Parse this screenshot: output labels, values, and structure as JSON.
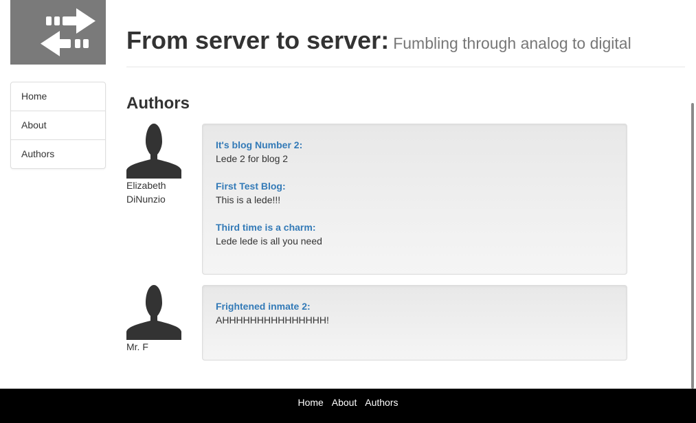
{
  "logo": {
    "icon": "swap-arrows-icon",
    "background": "#7a7a7a"
  },
  "header": {
    "title": "From server to server:",
    "subtitle": "Fumbling through analog to digital"
  },
  "sidenav": {
    "items": [
      {
        "label": "Home"
      },
      {
        "label": "About"
      },
      {
        "label": "Authors"
      }
    ]
  },
  "page": {
    "heading": "Authors"
  },
  "authors": [
    {
      "name_line1": "Elizabeth",
      "name_line2": "DiNunzio",
      "avatar_icon": "user-silhouette-icon",
      "posts": [
        {
          "title": "It's blog Number 2:",
          "lede": "Lede 2 for blog 2"
        },
        {
          "title": "First Test Blog:",
          "lede": "This is a lede!!!"
        },
        {
          "title": "Third time is a charm:",
          "lede": "Lede lede is all you need"
        }
      ]
    },
    {
      "name_line1": "Mr. F",
      "avatar_icon": "user-silhouette-icon",
      "posts": [
        {
          "title": "Frightened inmate 2:",
          "lede": "AHHHHHHHHHHHHHHH!"
        }
      ]
    }
  ],
  "footer": {
    "links": [
      {
        "label": "Home"
      },
      {
        "label": "About"
      },
      {
        "label": "Authors"
      }
    ]
  },
  "colors": {
    "link": "#337ab7",
    "text": "#333333",
    "subtitle": "#777777",
    "footer_bg": "#000000"
  }
}
